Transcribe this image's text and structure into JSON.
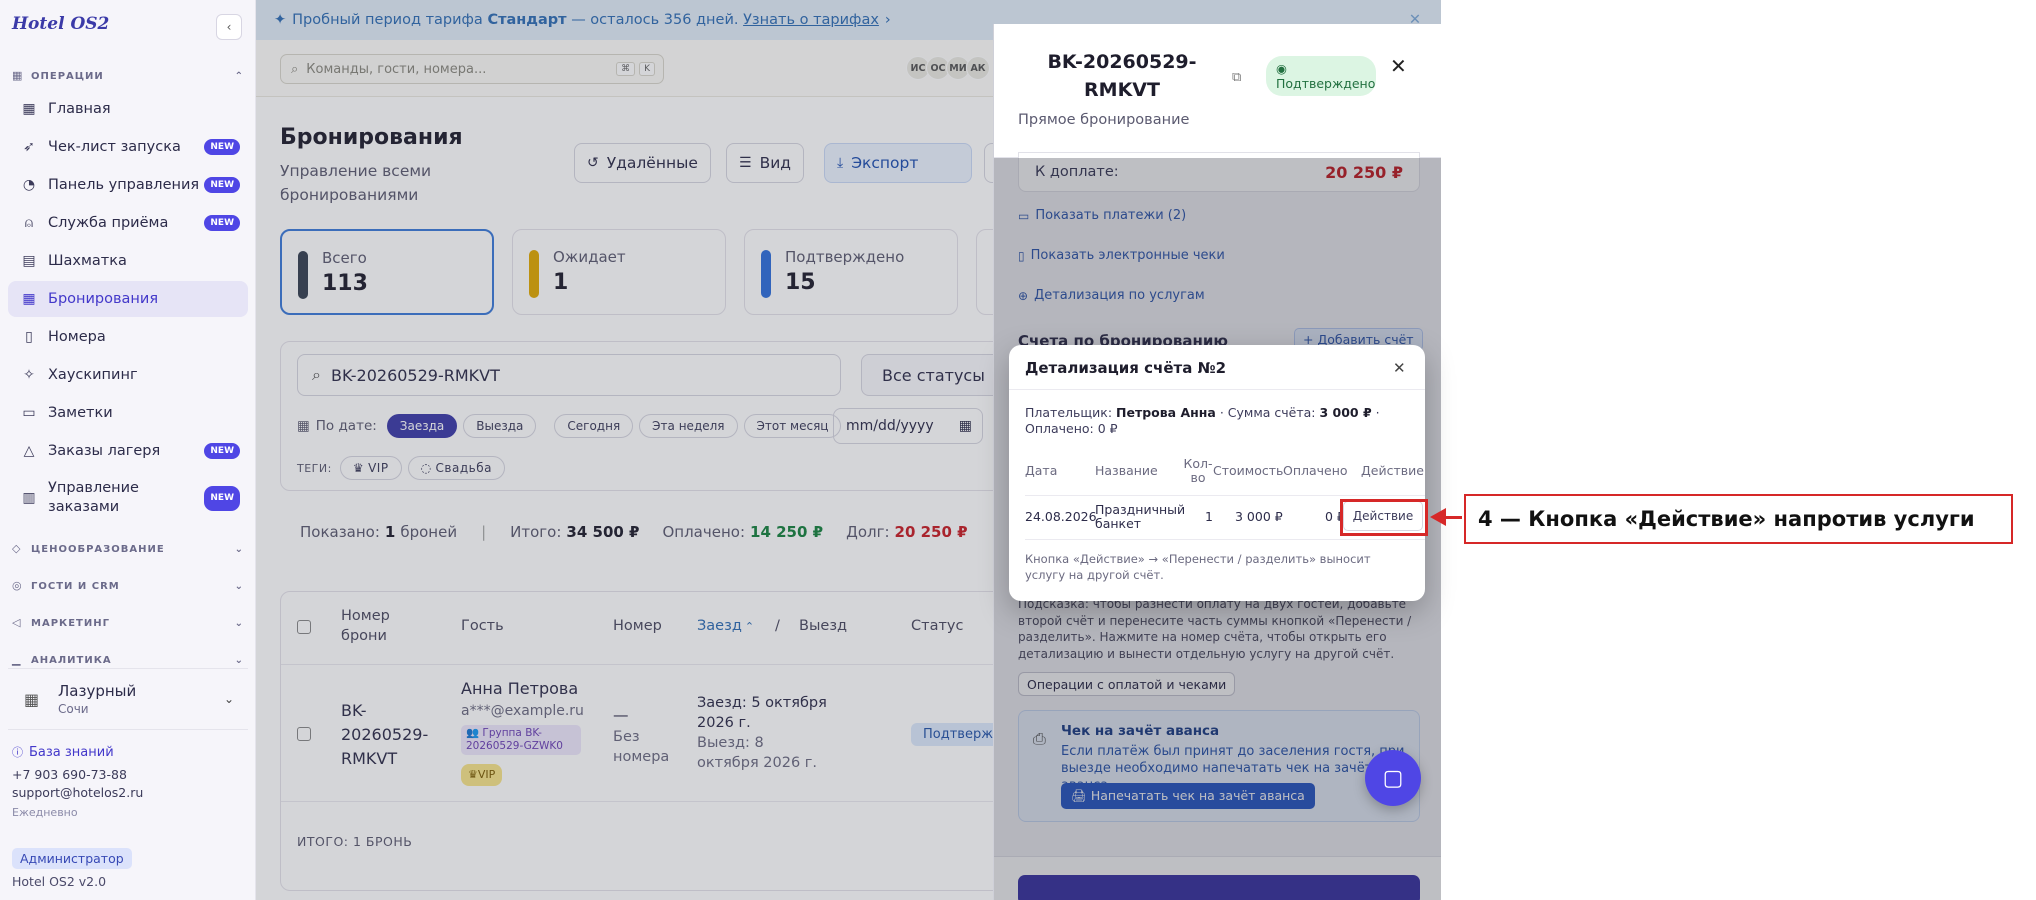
{
  "sidebar": {
    "logo": "Hotel OS2",
    "sections": {
      "operations": "ОПЕРАЦИИ",
      "pricing": "ЦЕНООБРАЗОВАНИЕ",
      "guests": "ГОСТИ И CRM",
      "marketing": "МАРКЕТИНГ",
      "analytics": "АНАЛИТИКА"
    },
    "items": [
      {
        "label": "Главная",
        "icon": "grid-icon",
        "badge": ""
      },
      {
        "label": "Чек-лист запуска",
        "icon": "rocket-icon",
        "badge": "NEW"
      },
      {
        "label": "Панель управления",
        "icon": "gauge-icon",
        "badge": "NEW"
      },
      {
        "label": "Служба приёма",
        "icon": "bell-icon",
        "badge": "NEW"
      },
      {
        "label": "Шахматка",
        "icon": "table-icon",
        "badge": ""
      },
      {
        "label": "Бронирования",
        "icon": "calendar-icon",
        "badge": ""
      },
      {
        "label": "Номера",
        "icon": "door-icon",
        "badge": ""
      },
      {
        "label": "Хаускипинг",
        "icon": "sparkle-icon",
        "badge": ""
      },
      {
        "label": "Заметки",
        "icon": "note-icon",
        "badge": ""
      },
      {
        "label": "Заказы лагеря",
        "icon": "tent-icon",
        "badge": "NEW"
      },
      {
        "label": "Управление заказами",
        "icon": "receipt-icon",
        "badge": "NEW"
      }
    ],
    "hotel": {
      "name": "Лазурный",
      "city": "Сочи"
    },
    "knowledge_base": "База знаний",
    "phone": "+7 903 690-73-88",
    "email": "support@hotelos2.ru",
    "schedule": "Ежедневно",
    "role": "Администратор",
    "version": "Hotel OS2 v2.0"
  },
  "trial": {
    "prefix": "Пробный период тарифа",
    "plan": "Стандарт",
    "days": "— осталось 356 дней.",
    "link": "Узнать о тарифах"
  },
  "topbar": {
    "search_placeholder": "Команды, гости, номера...",
    "kbd1": "⌘",
    "kbd2": "K",
    "avatars": [
      "ИС",
      "ОС",
      "МИ",
      "АК"
    ]
  },
  "page": {
    "title": "Бронирования",
    "subtitle": "Управление всеми бронированиями",
    "deleted": "Удалённые",
    "view": "Вид",
    "export": "Экспорт"
  },
  "stats": [
    {
      "label": "Всего",
      "value": "113",
      "color": "#374151"
    },
    {
      "label": "Ожидает",
      "value": "1",
      "color": "#e0a800"
    },
    {
      "label": "Подтверждено",
      "value": "15",
      "color": "#2f6fdb"
    }
  ],
  "filters": {
    "search": "BK-20260529-RMKVT",
    "status": "Все статусы",
    "by_date": "По дате:",
    "checkin": "Заезда",
    "checkout": "Выезда",
    "today": "Сегодня",
    "week": "Эта неделя",
    "month": "Этот месяц",
    "date_placeholder": "mm/dd/yyyy",
    "tags_label": "ТЕГИ:",
    "tag_vip": "VIP",
    "tag_wedding": "Свадьба"
  },
  "summary": {
    "shown_label": "Показано:",
    "shown_count": "1",
    "shown_suffix": "броней",
    "total_label": "Итого:",
    "total": "34 500 ₽",
    "paid_label": "Оплачено:",
    "paid": "14 250 ₽",
    "debt_label": "Долг:",
    "debt": "20 250 ₽"
  },
  "table": {
    "headers": {
      "number": "Номер брони",
      "guest": "Гость",
      "room": "Номер",
      "checkin": "Заезд",
      "slash": "/",
      "checkout": "Выезд",
      "status": "Статус"
    },
    "row": {
      "number": "BK-20260529-RMKVT",
      "guest": "Анна Петрова",
      "email": "a***@example.ru",
      "group": "👥 Группа BK-20260529-GZWK0",
      "vip": "VIP",
      "room": "—",
      "room_note": "Без номера",
      "checkin": "Заезд: 5 октября 2026 г.",
      "checkout": "Выезд: 8 октября 2026 г.",
      "status": "Подтверждено"
    },
    "total": "ИТОГО: 1 БРОНЬ"
  },
  "drawer": {
    "title": "BK-20260529-RMKVT",
    "status": "Подтверждено",
    "subtitle": "Прямое бронирование",
    "due_label": "К доплате:",
    "due_value": "20 250 ₽",
    "show_payments": "Показать платежи (2)",
    "show_receipts": "Показать электронные чеки",
    "service_details": "Детализация по услугам",
    "invoices": "Счета по бронированию",
    "add_invoice": "+ Добавить счёт",
    "hint": "Подсказка: чтобы разнести оплату на двух гостей, добавьте второй счёт и перенесите часть суммы кнопкой «Перенести / разделить». Нажмите на номер счёта, чтобы открыть его детализацию и вынести отдельную услугу на другой счёт.",
    "ops": "Операции с оплатой и чеками",
    "advance_title": "Чек на зачёт аванса",
    "advance_text": "Если платёж был принят до заселения гостя, при выезде необходимо напечатать чек на зачёт аванса.",
    "advance_btn": "🖨 Напечатать чек на зачёт аванса"
  },
  "modal": {
    "title": "Детализация счёта №2",
    "payer_label": "Плательщик:",
    "payer": "Петрова Анна",
    "sum_label": "· Сумма счёта:",
    "sum": "3 000 ₽",
    "paid_line": "· Оплачено: 0 ₽",
    "headers": {
      "date": "Дата",
      "name": "Название",
      "qty": "Кол-во",
      "cost": "Стоимость",
      "paid": "Оплачено",
      "action": "Действие"
    },
    "row": {
      "date": "24.08.2026",
      "name": "Праздничный банкет",
      "qty": "1",
      "cost": "3 000 ₽",
      "paid": "0 ₽",
      "action": "Действие"
    },
    "note": "Кнопка «Действие» → «Перенести / разделить» выносит услугу на другой счёт."
  },
  "annotation": {
    "label": "4 — Кнопка «Действие» напротив услуги",
    "color": "#d62828"
  }
}
